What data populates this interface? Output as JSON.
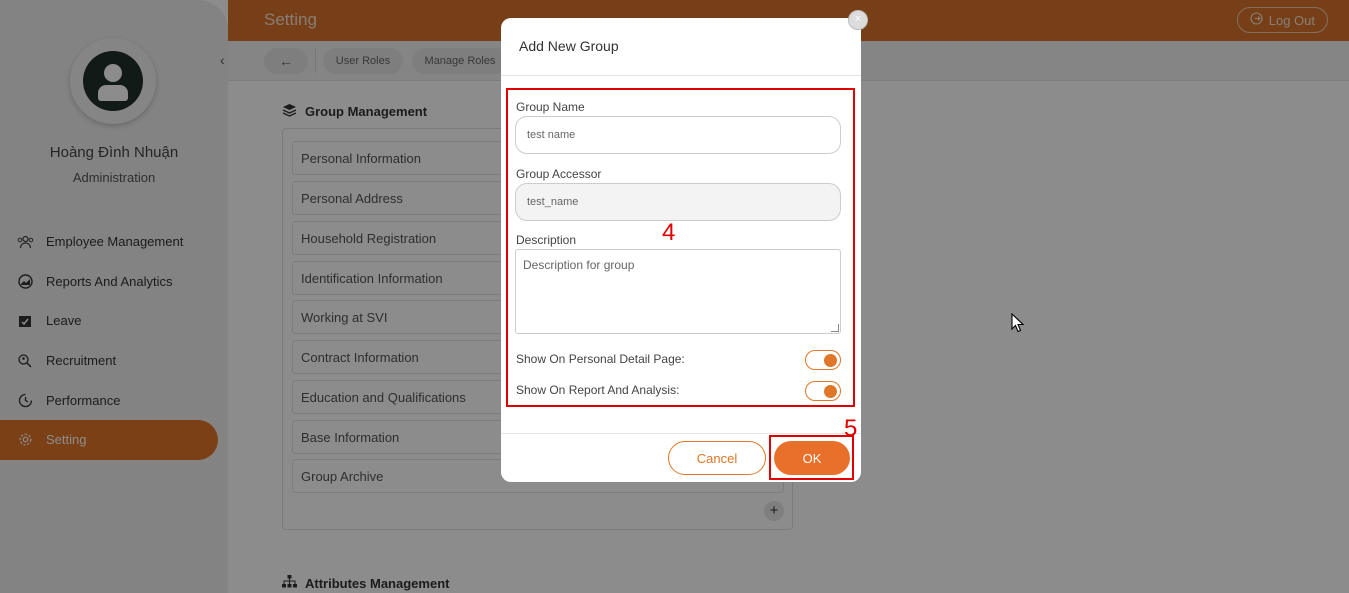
{
  "sidebar": {
    "user_name": "Hoàng Đình Nhuận",
    "user_role": "Administration",
    "collapse_icon": "‹",
    "items": [
      {
        "label": "Employee Management",
        "icon": "users-icon"
      },
      {
        "label": "Reports And Analytics",
        "icon": "chart-icon"
      },
      {
        "label": "Leave",
        "icon": "calendar-check-icon"
      },
      {
        "label": "Recruitment",
        "icon": "recruit-icon"
      },
      {
        "label": "Performance",
        "icon": "performance-icon"
      },
      {
        "label": "Setting",
        "icon": "gear-icon",
        "active": true
      }
    ]
  },
  "header": {
    "title": "Setting",
    "logout_label": "Log Out"
  },
  "tabs": {
    "back_icon": "←",
    "items": [
      "User Roles",
      "Manage Roles"
    ]
  },
  "main": {
    "group_management_title": "Group Management",
    "groups": [
      "Personal Information",
      "Personal Address",
      "Household Registration",
      "Identification Information",
      "Working at SVI",
      "Contract Information",
      "Education and Qualifications",
      "Base Information",
      "Group Archive"
    ],
    "add_symbol": "+",
    "attributes_management_title": "Attributes Management"
  },
  "modal": {
    "title": "Add New Group",
    "close_symbol": "×",
    "group_name_label": "Group Name",
    "group_name_value": "test name",
    "group_accessor_label": "Group Accessor",
    "group_accessor_value": "test_name",
    "description_label": "Description",
    "description_value": "Description for group",
    "toggle_personal_label": "Show On Personal Detail Page:",
    "toggle_personal_on": true,
    "toggle_report_label": "Show On Report And Analysis:",
    "toggle_report_on": true,
    "cancel_label": "Cancel",
    "ok_label": "OK"
  },
  "annotations": {
    "form_step": "4",
    "ok_step": "5"
  },
  "colors": {
    "accent": "#e07628",
    "annotation": "#e00000",
    "sidebar_bg": "#efefef"
  }
}
